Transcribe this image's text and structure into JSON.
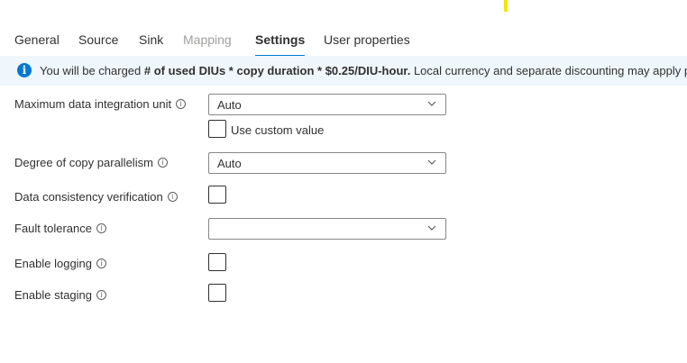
{
  "tabs": [
    {
      "label": "General",
      "state": "normal"
    },
    {
      "label": "Source",
      "state": "normal"
    },
    {
      "label": "Sink",
      "state": "normal"
    },
    {
      "label": "Mapping",
      "state": "disabled"
    },
    {
      "label": "Settings",
      "state": "active"
    },
    {
      "label": "User properties",
      "state": "normal"
    }
  ],
  "banner": {
    "icon": "info-icon",
    "prefix": "You will be charged ",
    "bold": "# of used DIUs * copy duration * $0.25/DIU-hour.",
    "suffix": " Local currency and separate discounting may apply p"
  },
  "settings": {
    "max_diu": {
      "label": "Maximum data integration unit",
      "value": "Auto",
      "custom_label": "Use custom value",
      "custom_checked": false
    },
    "parallelism": {
      "label": "Degree of copy parallelism",
      "value": "Auto"
    },
    "consistency": {
      "label": "Data consistency verification",
      "checked": false
    },
    "fault_tolerance": {
      "label": "Fault tolerance",
      "value": ""
    },
    "logging": {
      "label": "Enable logging",
      "checked": false
    },
    "staging": {
      "label": "Enable staging",
      "checked": false
    }
  },
  "colors": {
    "accent": "#0078d4",
    "banner_bg": "#eff6fc",
    "border": "#8a8886",
    "disabled_text": "#a19f9d"
  }
}
